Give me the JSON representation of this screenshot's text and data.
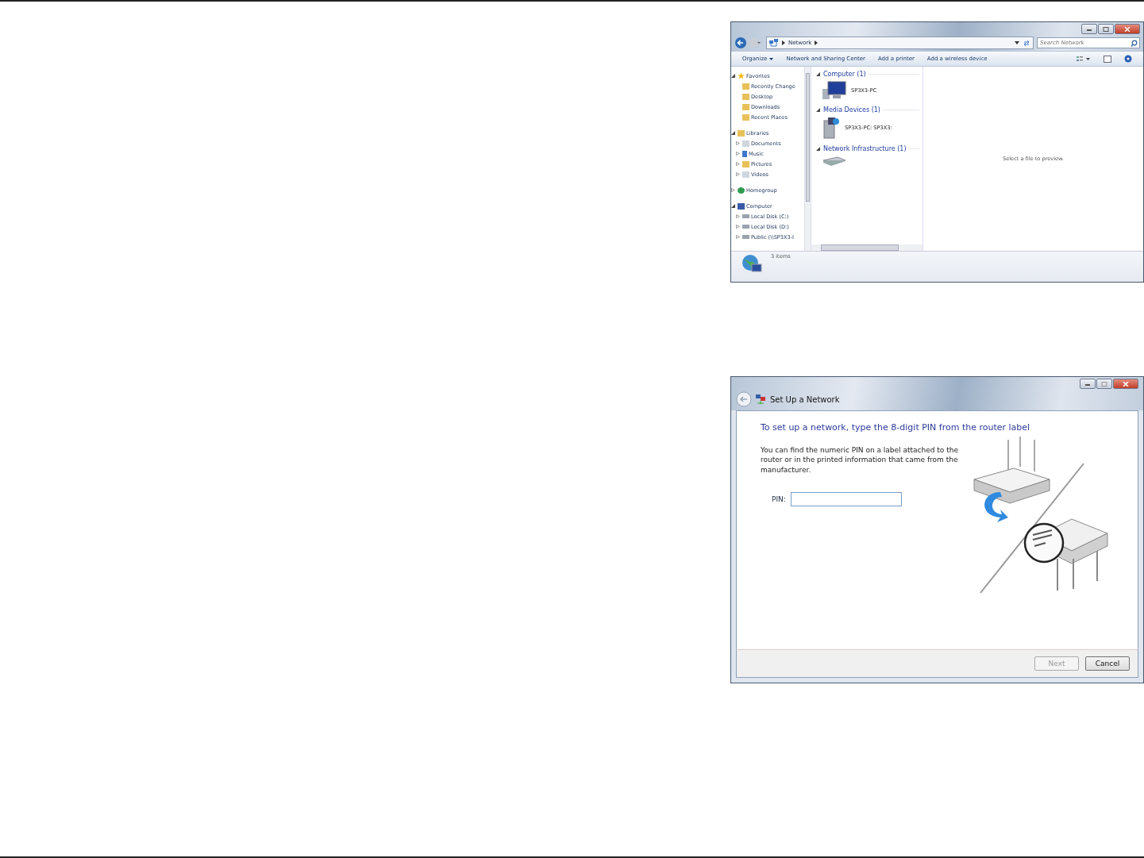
{
  "explorer": {
    "breadcrumb": [
      "Network"
    ],
    "search": {
      "placeholder": "Search Network"
    },
    "toolbar": [
      {
        "label": "Organize",
        "kind": "menu"
      },
      {
        "label": "Network and Sharing Center",
        "kind": "plain"
      },
      {
        "label": "Add a printer",
        "kind": "plain"
      },
      {
        "label": "Add a wireless device",
        "kind": "plain"
      }
    ],
    "nav": [
      {
        "label": "Favorites",
        "expanded": true,
        "children": [
          {
            "label": "Recently Change"
          },
          {
            "label": "Desktop"
          },
          {
            "label": "Downloads"
          },
          {
            "label": "Recent Places"
          }
        ]
      },
      {
        "label": "Libraries",
        "expanded": true,
        "children": [
          {
            "label": "Documents",
            "expanded": false
          },
          {
            "label": "Music",
            "expanded": false
          },
          {
            "label": "Pictures",
            "expanded": false
          },
          {
            "label": "Videos",
            "expanded": false
          }
        ]
      },
      {
        "label": "Homegroup",
        "expanded": false
      },
      {
        "label": "Computer",
        "expanded": true,
        "children": [
          {
            "label": "Local Disk (C:)",
            "expanded": false
          },
          {
            "label": "Local Disk (D:)",
            "expanded": false
          },
          {
            "label": "Public (\\\\SP3X3-I",
            "expanded": false
          }
        ]
      }
    ],
    "groups": [
      {
        "title": "Computer (1)",
        "items": [
          {
            "kind": "computer",
            "label": "SP3X3-PC"
          }
        ]
      },
      {
        "title": "Media Devices (1)",
        "items": [
          {
            "kind": "media",
            "label": "SP3X3-PC: SP3X3:"
          }
        ]
      },
      {
        "title": "Network Infrastructure (1)",
        "items": [
          {
            "kind": "router"
          }
        ]
      }
    ],
    "preview": "Select a file to preview.",
    "status": "3 items"
  },
  "dialog": {
    "title": "Set Up a Network",
    "heading": "To set up a network, type the 8-digit PIN from the router label",
    "body": "You can find the numeric PIN on a label attached to the router or in the printed information that came from the manufacturer.",
    "pin_label": "PIN:",
    "buttons": [
      {
        "label": "Next",
        "disabled": true
      },
      {
        "label": "Cancel",
        "disabled": false
      }
    ]
  }
}
